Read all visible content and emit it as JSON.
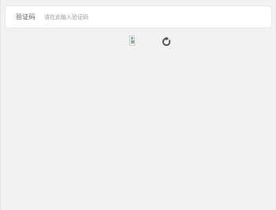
{
  "form": {
    "captcha_label": "验证码",
    "captcha_placeholder": "请在此输入验证码"
  },
  "captcha": {
    "image_icon": "broken-image-icon",
    "refresh_icon": "refresh-icon"
  }
}
